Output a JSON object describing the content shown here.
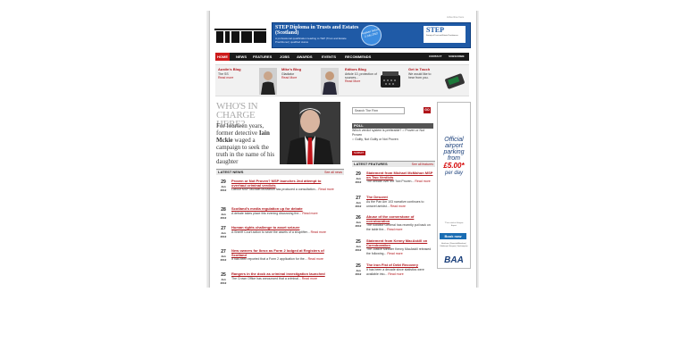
{
  "header": {
    "top_link": "Advertise here",
    "nav": [
      "HOME",
      "NEWS",
      "FEATURES",
      "JOBS",
      "AWARDS",
      "EVENTS",
      "RECOMMENDS"
    ],
    "nav_right": [
      "CONTACT",
      "SUBSCRIBE"
    ],
    "banner": {
      "title": "STEP Diploma in Trusts and Estates (Scotland)",
      "subtitle": "A professional qualification leading to TEP (Trust and Estate Practitioner) qualified status",
      "badge": "Register before 2 July 2012",
      "logo": "STEP",
      "logo_sub": "Society of Trust and Estate Practitioners"
    }
  },
  "blogs": [
    {
      "title": "Austin's Blog",
      "sub": "The SS",
      "link": "Read more"
    },
    {
      "title": "Mike's Blog",
      "sub": "Gladiator",
      "link": "Read More"
    },
    {
      "title": "Editors Blog",
      "sub": "Article 10, protection of sources...",
      "link": "Read More"
    },
    {
      "title": "Get in Touch",
      "sub": "We would like to hear from you.",
      "link": ""
    }
  ],
  "feature": {
    "heading": "WHO'S IN CHARGE HERE?",
    "pre": "For fourteen years, former detective",
    "name": "Iain Mckie",
    "post": "waged a campaign to seek the truth in the name of his daughter"
  },
  "search": {
    "placeholder": "Search The Firm",
    "button": "GO"
  },
  "poll": {
    "heading": "POLL",
    "question": "Which verdict system is preferable?",
    "options": [
      "Proven or Not Proven",
      "Guilty, Not Guilty or Not Proven"
    ],
    "button": "SUBMIT"
  },
  "latest_news": {
    "heading": "LATEST NEWS",
    "more": "See all news",
    "items": [
      {
        "day": "29",
        "month": "Jun",
        "year": "2012",
        "title": "Proven or Not Proven? MSP launches 2nd attempt to overhaul criminal verdicts",
        "summary": "Labour MSP Michael McMahon has produced a consultation...",
        "rm": "Read more"
      },
      {
        "day": "28",
        "month": "Jun",
        "year": "2012",
        "title": "Scotland's media regulation up for debate",
        "summary": "A debate takes place this evening discussing the...",
        "rm": "Read more"
      },
      {
        "day": "27",
        "month": "Jun",
        "year": "2012",
        "title": "Human rights challenge to asset seizure",
        "summary": "A Sheriff Court action to seize the assets of a shoplifter...",
        "rm": "Read more"
      },
      {
        "day": "27",
        "month": "Jun",
        "year": "2012",
        "title": "New owners for Ibrox as Form 2 lodged at Registers of Scotland",
        "summary": "It has been reported that a Form 2 application for the...",
        "rm": "Read more"
      },
      {
        "day": "25",
        "month": "Jun",
        "year": "2012",
        "title": "Rangers in the dock as criminal investigation launched",
        "summary": "The Crown Office has announced that a criminal...",
        "rm": "Read more"
      }
    ]
  },
  "latest_features": {
    "heading": "LATEST FEATURES",
    "more": "See all features",
    "items": [
      {
        "day": "29",
        "month": "Jun",
        "year": "2012",
        "title": "Statement from Michael McMahon MSP on Two Verdicts",
        "summary": "The debate over the 'Not Proven...",
        "rm": "Read more"
      },
      {
        "day": "27",
        "month": "Jun",
        "year": "2012",
        "title": "The Descent",
        "summary": "As the Pan Am 103 narrative continues to unravel amidst...",
        "rm": "Read more"
      },
      {
        "day": "26",
        "month": "Jun",
        "year": "2012",
        "title": "Abuse of the cornerstone of corroboration",
        "summary": "The Solicitor General has recently put back on the table the...",
        "rm": "Read more"
      },
      {
        "day": "25",
        "month": "Jun",
        "year": "2012",
        "title": "Statement from Kenny MacAskill on Corroboration",
        "summary": "The Justice Minister Kenny MacAskill released the following...",
        "rm": "Read more"
      },
      {
        "day": "25",
        "month": "Jun",
        "year": "2012",
        "title": "The Iron Fist of Debt Recovery",
        "summary": "It has been a decade since statistics were available into...",
        "rm": "Read more"
      }
    ]
  },
  "ad": {
    "line1": "Official airport parking from",
    "price": "£5.00*",
    "line2": "per day",
    "fine": "*Price valid at Glasgow Airport",
    "button": "Book now",
    "airports": "Heathrow | Stansted Aberdeen | Edinburgh Glasgow | Southampton",
    "brand": "BAA"
  },
  "colors": {
    "accent": "#b0141a",
    "nav": "#1a1a1a",
    "banner": "#1f5aa6"
  }
}
